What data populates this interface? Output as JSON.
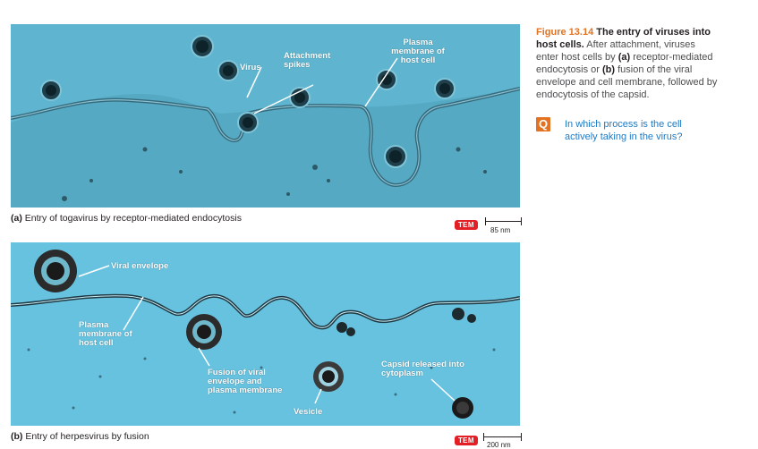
{
  "panel_a": {
    "labels": {
      "virus": "Virus",
      "attachment_spikes": "Attachment spikes",
      "plasma_membrane": "Plasma membrane of host cell"
    },
    "caption_letter": "(a)",
    "caption": "Entry of togavirus by receptor-mediated endocytosis",
    "tem_badge": "TEM",
    "scale_label": "85 nm"
  },
  "panel_b": {
    "labels": {
      "viral_envelope": "Viral envelope",
      "plasma_membrane": "Plasma membrane of host cell",
      "fusion": "Fusion of viral envelope and plasma membrane",
      "vesicle": "Vesicle",
      "capsid_released": "Capsid released into cytoplasm"
    },
    "caption_letter": "(b)",
    "caption": "Entry of herpesvirus by fusion",
    "tem_badge": "TEM",
    "scale_label": "200 nm"
  },
  "figure": {
    "number": "Figure 13.14",
    "title": "The entry of viruses into host cells.",
    "text_1": "After attachment, viruses enter host cells by",
    "ref_a": "(a)",
    "text_2": "receptor-mediated endocytosis or",
    "ref_b": "(b)",
    "text_3": "fusion of the viral envelope and cell membrane, followed by endocytosis of the capsid."
  },
  "question": {
    "icon": "Q",
    "text": "In which process is the cell actively taking in the virus?"
  },
  "colors": {
    "tem_badge": "#e31e24",
    "figure_number": "#e37222",
    "question_text": "#1f7ac2",
    "micrograph_a": "#5fb5cf",
    "micrograph_b": "#67c2df"
  }
}
